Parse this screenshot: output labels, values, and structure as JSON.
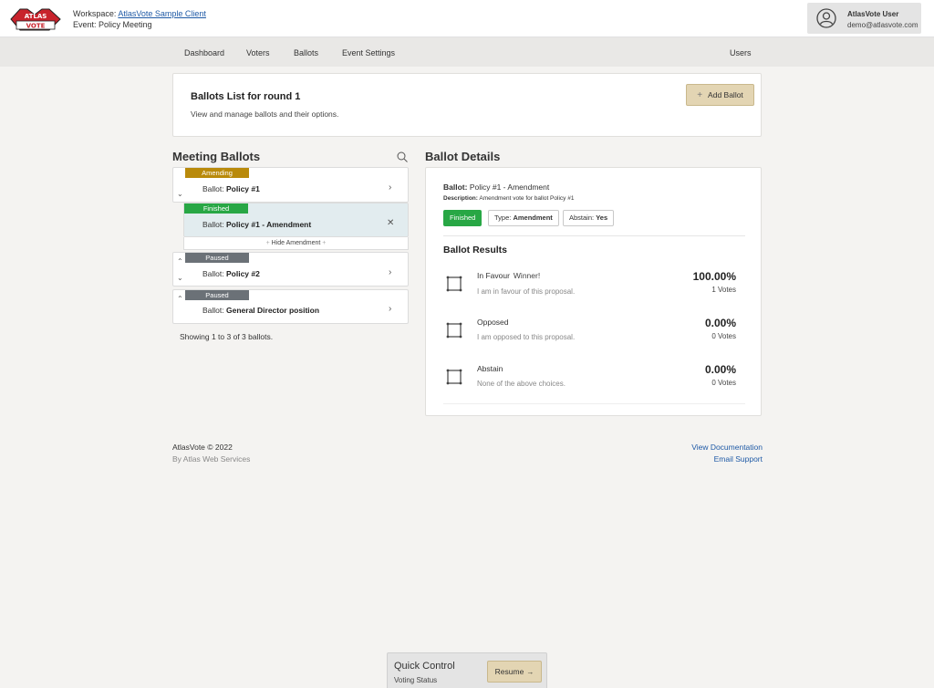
{
  "workspace": {
    "label": "Workspace:",
    "name": "AtlasVote Sample Client",
    "event_label": "Event:",
    "event": "Policy Meeting"
  },
  "logo": {
    "top": "ATLAS",
    "bottom": "VOTE"
  },
  "user": {
    "name": "AtlasVote User",
    "email": "demo@atlasvote.com"
  },
  "nav": {
    "items": [
      "Dashboard",
      "Voters",
      "Ballots",
      "Event Settings"
    ],
    "right": "Users"
  },
  "page_header": {
    "title": "Ballots List for round 1",
    "subtitle": "View and manage ballots and their options.",
    "add_button": "Add Ballot"
  },
  "meeting_ballots": {
    "title": "Meeting Ballots",
    "ballot_prefix": "Ballot:",
    "items": [
      {
        "status": "Amending",
        "name": "Policy #1"
      },
      {
        "status": "Finished",
        "name": "Policy #1 - Amendment"
      },
      {
        "status": "Paused",
        "name": "Policy #2"
      },
      {
        "status": "Paused",
        "name": "General Director position"
      }
    ],
    "hide_amendment": "Hide Amendment",
    "showing": "Showing 1 to 3 of 3 ballots."
  },
  "ballot_details": {
    "title": "Ballot Details",
    "ballot_label": "Ballot:",
    "ballot_name": "Policy #1 - Amendment",
    "description_label": "Description:",
    "description": "Amendment vote for ballot Policy #1",
    "status_tag": "Finished",
    "type_label": "Type:",
    "type_value": "Amendment",
    "abstain_label": "Abstain:",
    "abstain_value": "Yes",
    "results_title": "Ballot Results",
    "options": [
      {
        "name": "In Favour",
        "winner": "Winner!",
        "description": "I am in favour of this proposal.",
        "percent": "100.00%",
        "votes": "1 Votes"
      },
      {
        "name": "Opposed",
        "winner": "",
        "description": "I am opposed to this proposal.",
        "percent": "0.00%",
        "votes": "0 Votes"
      },
      {
        "name": "Abstain",
        "winner": "",
        "description": "None of the above choices.",
        "percent": "0.00%",
        "votes": "0 Votes"
      }
    ]
  },
  "footer": {
    "copyright": "AtlasVote © 2022",
    "by": "By Atlas Web Services",
    "docs": "View Documentation",
    "support": "Email Support"
  },
  "quick_control": {
    "title": "Quick Control",
    "subtitle": "Voting Status",
    "button": "Resume"
  },
  "colors": {
    "amending": "#b98a0b",
    "finished": "#28a745",
    "paused": "#6b7177",
    "accent_button": "#e3d5b3",
    "link": "#1f5aa6"
  }
}
